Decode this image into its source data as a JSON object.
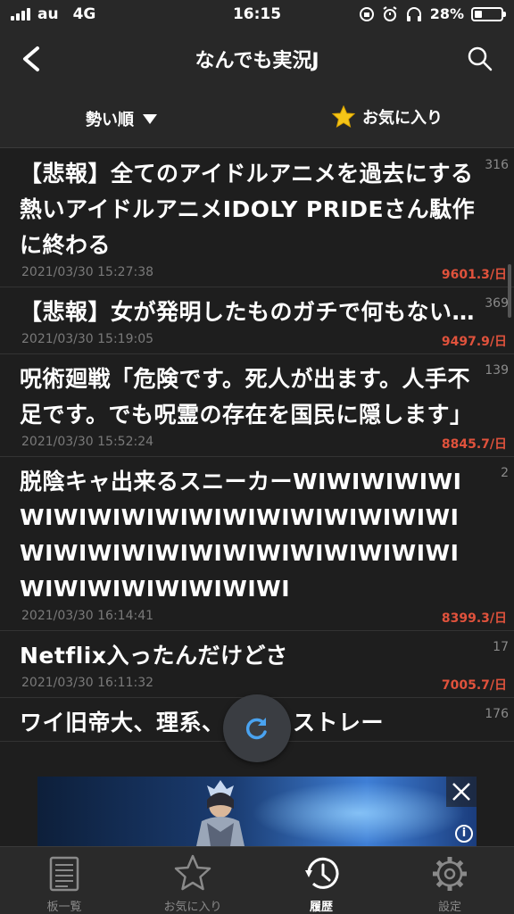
{
  "status_bar": {
    "carrier": "au",
    "network": "4G",
    "time": "16:15",
    "battery": "28%",
    "battery_level": 0.28
  },
  "nav": {
    "title": "なんでも実況J",
    "back_icon": "chevron-left-icon",
    "search_icon": "search-icon"
  },
  "sort_bar": {
    "sort_label": "勢い順",
    "favorites_label": "お気に入り"
  },
  "threads": [
    {
      "title": "【悲報】全てのアイドルアニメを過去にする熱いアイドルアニメIDOLY PRIDEさん駄作に終わる",
      "count": "316",
      "date": "2021/03/30 15:27:38",
      "speed": "9601.3/日"
    },
    {
      "title": "【悲報】女が発明したものガチで何もない…",
      "count": "369",
      "date": "2021/03/30 15:19:05",
      "speed": "9497.9/日"
    },
    {
      "title": "呪術廻戦「危険です。死人が出ます。人手不足です。でも呪霊の存在を国民に隠します」",
      "count": "139",
      "date": "2021/03/30 15:52:24",
      "speed": "8845.7/日"
    },
    {
      "title": "脱陰キャ出来るスニーカーWIWIWIWIWIWIWIWIWIWIWIWIWIWIWIWIWIWIWIWIWIWIWIWIWIWIWIWIWIWIWIWIWIWIWIWIWIWIWI",
      "count": "2",
      "date": "2021/03/30 16:14:41",
      "speed": "8399.3/日"
    },
    {
      "title": "Netflix入ったんだけどさ",
      "count": "17",
      "date": "2021/03/30 16:11:32",
      "speed": "7005.7/日"
    },
    {
      "title": "ワイ旧帝大、理系、修士、ストレー",
      "count": "176",
      "date": "",
      "speed": ""
    }
  ],
  "tabs": [
    {
      "label": "板一覧",
      "icon": "newspaper-icon"
    },
    {
      "label": "お気に入り",
      "icon": "star-icon"
    },
    {
      "label": "履歴",
      "icon": "clock-history-icon"
    },
    {
      "label": "設定",
      "icon": "gear-icon"
    }
  ],
  "colors": {
    "background": "#1e1e1e",
    "bar": "#282828",
    "speed": "#e0523c",
    "refresh": "#4aa3f0",
    "star": "#f5c518"
  }
}
